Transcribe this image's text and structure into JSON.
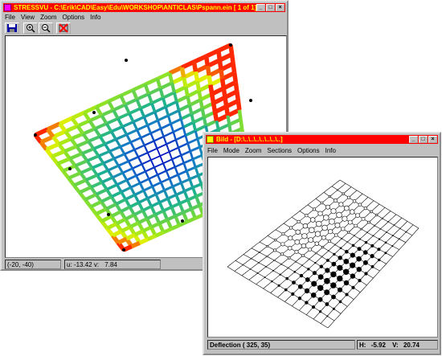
{
  "stressvu": {
    "title": "STRESSVU - C:\\Erik\\CAD\\Easy\\Edu\\WORKSHOP\\ANTICLAS\\Pspann.ein [ 1 of  1]",
    "menu": [
      "File",
      "View",
      "Zoom",
      "Options",
      "Info"
    ],
    "toolbar": [
      "save-icon",
      "zoom-in-icon",
      "zoom-out-icon",
      "delete-icon"
    ],
    "status": {
      "coords": "(-20, -40)",
      "u_label": "u:",
      "u_value": "-13.42",
      "v_label": "v:",
      "v_value": "7.84"
    },
    "window_controls": [
      "minimize",
      "maximize",
      "close"
    ]
  },
  "bild": {
    "title": "Bild - [D:\\..\\..\\..\\..\\..\\..\\..]",
    "menu": [
      "File",
      "Mode",
      "Zoom",
      "Sections",
      "Options",
      "Info"
    ],
    "status": {
      "deflection": "Deflection ( 325,  35)",
      "h_label": "H:",
      "h_value": "-5.92",
      "v_label": "V:",
      "v_value": "20.74"
    },
    "window_controls": [
      "minimize",
      "maximize",
      "close"
    ]
  },
  "colors": {
    "title_bg": "#ff0000",
    "title_text": "#ffff00",
    "window_face": "#c0c0c0",
    "stress_low": "#0000c0",
    "stress_mid": "#20b0a0",
    "stress_high": "#c0ff00",
    "stress_peak": "#ff2000"
  }
}
